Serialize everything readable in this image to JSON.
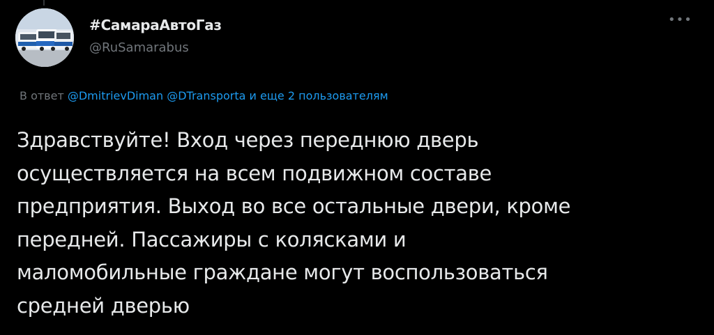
{
  "tweet": {
    "author": {
      "display_name": "#СамараАвтоГаз",
      "handle": "@RuSamarabus",
      "avatar_icon": "bus-photo-avatar"
    },
    "more_icon": "more-options-icon",
    "reply_to": {
      "prefix": "В ответ",
      "mention_1": "@DmitrievDiman",
      "mention_2": "@DTransporta",
      "suffix": "и еще 2 пользователям"
    },
    "text_lines": [
      "Здравствуйте! Вход через переднюю дверь",
      "осуществляется на всем подвижном составе",
      "предприятия. Выход во все остальные двери, кроме",
      "передней. Пассажиры с колясками и",
      "маломобильные граждане могут воспользоваться",
      "средней дверью"
    ]
  },
  "colors": {
    "background": "#000000",
    "text_primary": "#e7e9ea",
    "text_secondary": "#71767b",
    "link": "#1d9bf0"
  }
}
